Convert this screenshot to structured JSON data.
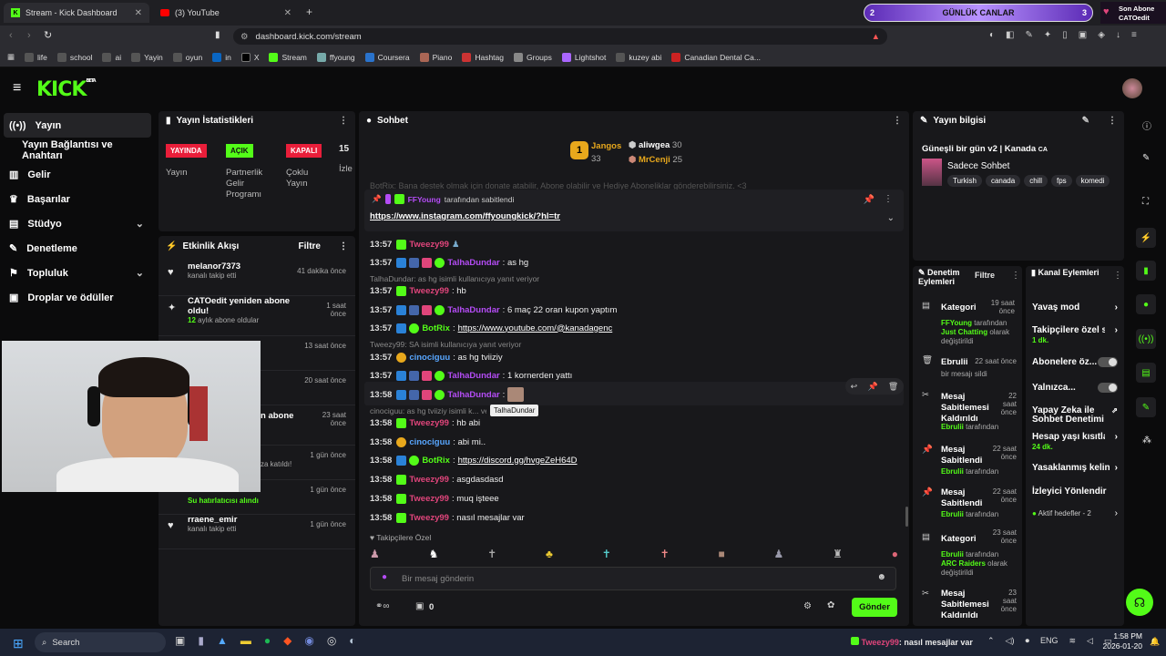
{
  "browser": {
    "tabs": [
      {
        "label": "Stream - Kick Dashboard"
      },
      {
        "label": "(3) YouTube"
      }
    ],
    "url": "dashboard.kick.com/stream",
    "bookmarks": [
      "life",
      "school",
      "ai",
      "Yayin",
      "oyun",
      "in",
      "X",
      "Stream",
      "ffyoung",
      "Coursera",
      "Piano",
      "Hashtag",
      "Groups",
      "Lightshot",
      "kuzey abi",
      "Canadian Dental Ca..."
    ]
  },
  "overlay": {
    "left": "2",
    "title": "GÜNLÜK CANLAR",
    "right": "3",
    "sub_title": "Son Abone",
    "sub_name": "CATOedit"
  },
  "kick": {
    "logo": "KICK",
    "beta": "BETA"
  },
  "nav": [
    {
      "label": "Yayın"
    },
    {
      "label": "Yayın Bağlantısı ve Anahtarı"
    },
    {
      "label": "Gelir"
    },
    {
      "label": "Başarılar"
    },
    {
      "label": "Stüdyo"
    },
    {
      "label": "Denetleme"
    },
    {
      "label": "Topluluk"
    },
    {
      "label": "Droplar ve ödüller"
    }
  ],
  "stats": {
    "title": "Yayın İstatistikleri",
    "badges": [
      "YAYINDA",
      "AÇIK",
      "KAPALI"
    ],
    "num": "15",
    "labels": [
      "Yayın",
      "Partnerlik Gelir Programı",
      "Çoklu Yayın",
      "İzle"
    ]
  },
  "events": {
    "title": "Etkinlik Akışı",
    "filter": "Filtre",
    "items": [
      {
        "title": "melanor7373",
        "sub": "kanalı takip etti",
        "when": "41 dakika önce"
      },
      {
        "title": "CATOedit yeniden abone oldu!",
        "sub_num": "12",
        "sub": " aylık abone oldular",
        "when": "1 saat önce"
      },
      {
        "title": "",
        "sub": "",
        "when": "13 saat önce"
      },
      {
        "title": "",
        "sub": "",
        "when": "20 saat önce"
      },
      {
        "title": "n abone",
        "sub": "",
        "when": "23 saat önce"
      },
      {
        "title": "",
        "sub": "za katıldı!",
        "when": "1 gün önce"
      },
      {
        "title": "",
        "sub": "Su hatırlatıcısı alındı",
        "when": "1 gün önce"
      },
      {
        "title": "rraene_emir",
        "sub": "kanalı takip etti",
        "when": "1 gün önce"
      }
    ]
  },
  "chat": {
    "title": "Sohbet",
    "top": [
      {
        "name": "Jangos",
        "val": "33"
      },
      {
        "name": "aliwgea",
        "val": "30"
      },
      {
        "name": "MrCenji",
        "val": "25"
      }
    ],
    "pinned_by": "FFYoung",
    "pinned_by_suffix": "tarafından sabitlendi",
    "pinned_link": "https://www.instagram.com/ffyoungkick/?hl=tr",
    "ghost": "BotRix: Bana destek olmak için donate atabilir, Abone olabilir ve Hediye Aboneliklar gönderebilirsiniz. <3",
    "messages": [
      {
        "time": "13:57",
        "user": "Tweezy99",
        "text": ""
      },
      {
        "time": "13:57",
        "user": "TalhaDundar",
        "text": ": as hg"
      },
      {
        "reply": "TalhaDundar: as hg isimli kullanıcıya yanıt veriyor"
      },
      {
        "time": "13:57",
        "user": "Tweezy99",
        "text": ": hb"
      },
      {
        "time": "13:57",
        "user": "TalhaDundar",
        "text": ": 6 maç 22 oran kupon yaptım"
      },
      {
        "time": "13:57",
        "user": "BotRix",
        "text": ": ",
        "link": "https://www.youtube.com/@kanadagenc"
      },
      {
        "reply": "Tweezy99:  SA  isimli kullanıcıya yanıt veriyor"
      },
      {
        "time": "13:57",
        "user": "cinociguu",
        "text": ": as hg tviiziy"
      },
      {
        "time": "13:57",
        "user": "TalhaDundar",
        "text": ": 1 kornerden yattı"
      },
      {
        "time": "13:58",
        "user": "TalhaDundar",
        "text": ":"
      },
      {
        "reply": "cinociguu: as hg tviiziy isimli k... veriyor"
      },
      {
        "time": "13:58",
        "user": "Tweezy99",
        "text": ": hb abi"
      },
      {
        "time": "13:58",
        "user": "cinociguu",
        "text": ": abi mi.."
      },
      {
        "time": "13:58",
        "user": "BotRix",
        "text": ": ",
        "link": "https://discord.gg/hvgeZeH64D"
      },
      {
        "time": "13:58",
        "user": "Tweezy99",
        "text": ": asgdasdasd"
      },
      {
        "time": "13:58",
        "user": "Tweezy99",
        "text": ": muq işteee"
      },
      {
        "time": "13:58",
        "user": "Tweezy99",
        "text": ": nasıl mesajlar var"
      }
    ],
    "tooltip": "TalhaDundar",
    "followers_label": "Takipçilere Özel",
    "placeholder": "Bir mesaj gönderin",
    "send": "Gönder",
    "count": "0"
  },
  "info": {
    "title": "Yayın bilgisi",
    "stream_title": "Güneşli bir gün v2 | Kanada",
    "cc": "CA",
    "category": "Sadece Sohbet",
    "tags": [
      "Turkish",
      "canada",
      "chill",
      "fps",
      "komedi"
    ]
  },
  "mod": {
    "title": "Denetim Eylemleri",
    "filter": "Filtre",
    "items": [
      {
        "t": "Kategori",
        "when": "19 saat önce",
        "l1": "FFYoung",
        "l1s": " tarafından",
        "l2": "Just Chatting",
        "l2s": " olarak değiştirildi"
      },
      {
        "t": "Ebrulii",
        "when": "22 saat önce",
        "l1": "",
        "l1s": "bir mesajı sildi",
        "l2": "",
        "l2s": ""
      },
      {
        "t": "Mesaj Sabitlemesi Kaldırıldı",
        "when": "22 saat önce",
        "l1": "Ebrulii",
        "l1s": " tarafından",
        "l2": "",
        "l2s": ""
      },
      {
        "t": "Mesaj Sabitlendi",
        "when": "22 saat önce",
        "l1": "Ebrulii",
        "l1s": " tarafından",
        "l2": "",
        "l2s": ""
      },
      {
        "t": "Mesaj Sabitlendi",
        "when": "22 saat önce",
        "l1": "Ebrulii",
        "l1s": " tarafından",
        "l2": "",
        "l2s": ""
      },
      {
        "t": "Kategori",
        "when": "23 saat önce",
        "l1": "Ebrulii",
        "l1s": " tarafından",
        "l2": "ARC Raiders",
        "l2s": " olarak değiştirildi"
      },
      {
        "t": "Mesaj Sabitlemesi Kaldırıldı",
        "when": "23 saat önce",
        "l1": "",
        "l1s": "",
        "l2": "",
        "l2s": ""
      }
    ]
  },
  "channel": {
    "title": "Kanal Eylemleri",
    "items": [
      "Yavaş mod",
      "Takipçilere özel s",
      "Abonelere öz...",
      "Yalnızca...",
      "Yapay Zeka ile Sohbet Denetimi",
      "Hesap yaşı kısıtla",
      "Yasaklanmış kelin",
      "İzleyici Yönlendir"
    ],
    "sub1": "1 dk.",
    "sub2": "24 dk.",
    "active": "Aktif hedefler - 2"
  },
  "taskbar": {
    "search": "Search",
    "ticker_user": "Tweezy99",
    "ticker_text": ": nasıl mesajlar var",
    "lang": "ENG",
    "time": "1:58 PM",
    "date": "2026-01-20"
  },
  "colors": {
    "kick_green": "#53fc18",
    "purple": "#b44cf5",
    "pink": "#e0457b",
    "blue": "#58a6ff"
  }
}
